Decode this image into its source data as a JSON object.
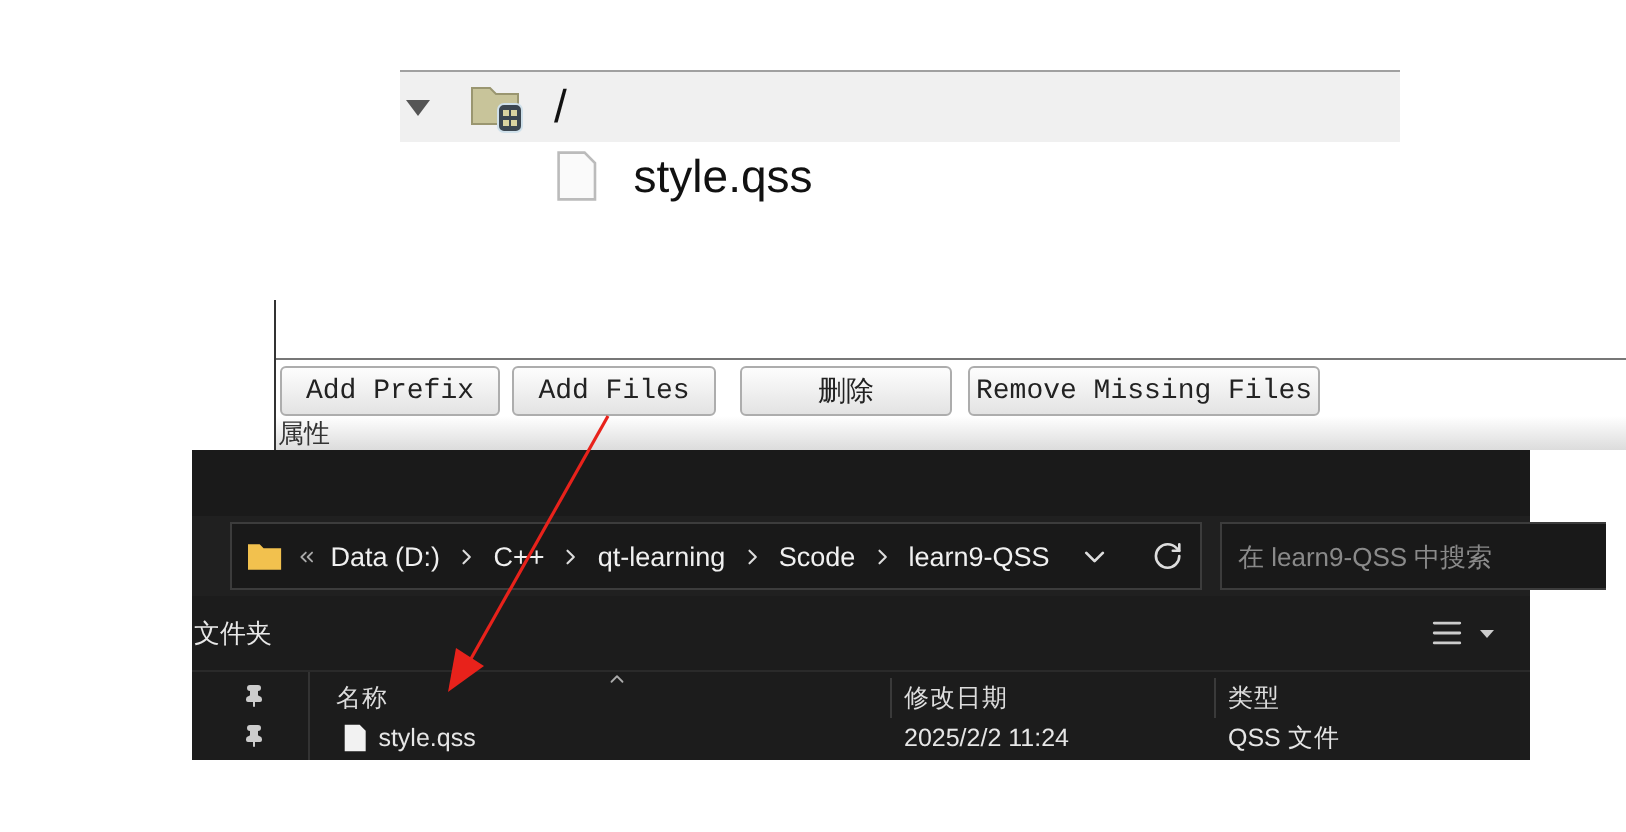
{
  "resource_tree": {
    "items": [
      {
        "label": "/",
        "kind": "folder",
        "expanded": true,
        "selected": true,
        "children": [
          {
            "label": "style.qss",
            "kind": "file",
            "selected": false
          }
        ]
      }
    ]
  },
  "resource_buttons": [
    "Add Prefix",
    "Add Files",
    "删除",
    "Remove Missing Files"
  ],
  "properties_label": "属性",
  "explorer": {
    "breadcrumb": [
      "Data (D:)",
      "C++",
      "qt-learning",
      "Scode",
      "learn9-QSS"
    ],
    "search": {
      "placeholder": "在 learn9-QSS 中搜索"
    },
    "toolbar_label": "文件夹",
    "columns": [
      "名称",
      "修改日期",
      "类型"
    ],
    "rows": [
      {
        "name": "style.qss",
        "modified": "2025/2/2 11:24",
        "type": "QSS 文件"
      }
    ]
  }
}
